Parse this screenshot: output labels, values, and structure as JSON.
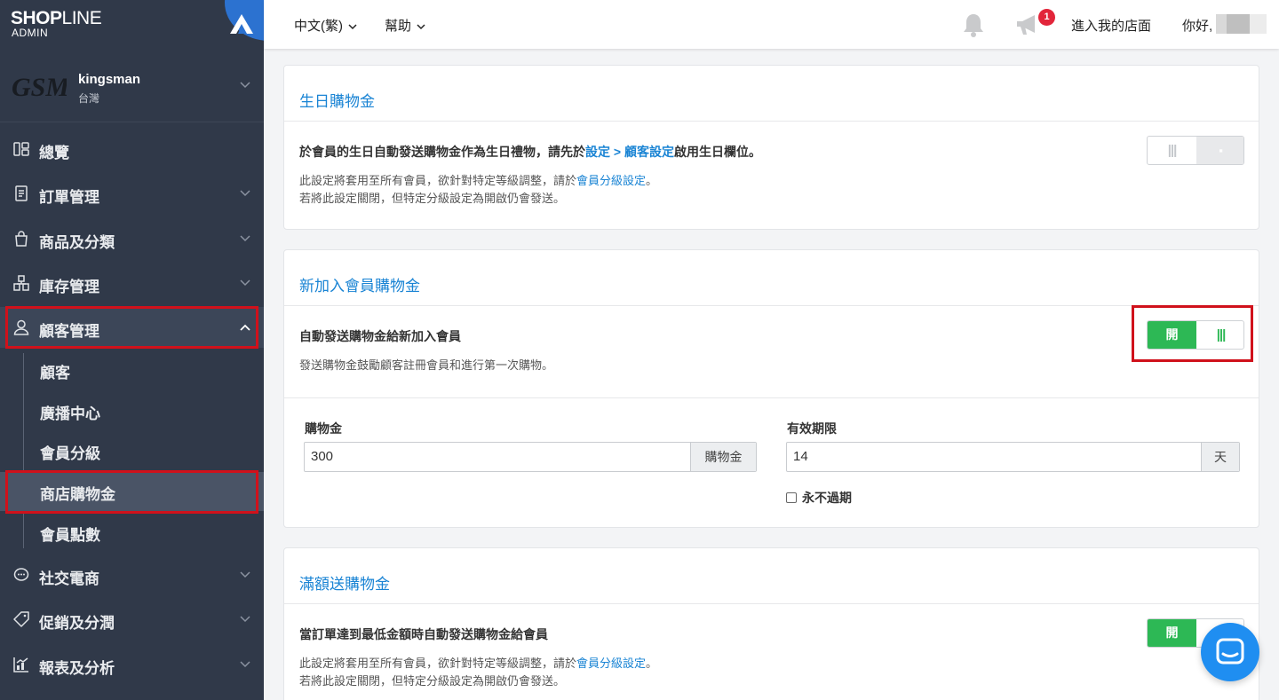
{
  "brand": {
    "name_bold": "SHOP",
    "name_light": "LINE",
    "sub": "ADMIN"
  },
  "store": {
    "logo_text": "GSM",
    "name": "kingsman",
    "region": "台灣"
  },
  "sidebar": {
    "items": [
      {
        "label": "總覽",
        "icon": "dashboard-icon"
      },
      {
        "label": "訂單管理",
        "icon": "order-icon"
      },
      {
        "label": "商品及分類",
        "icon": "bag-icon"
      },
      {
        "label": "庫存管理",
        "icon": "inventory-icon"
      },
      {
        "label": "顧客管理",
        "icon": "user-icon"
      },
      {
        "label": "社交電商",
        "icon": "chat-bubble-icon"
      },
      {
        "label": "促銷及分潤",
        "icon": "tag-icon"
      },
      {
        "label": "報表及分析",
        "icon": "chart-icon"
      }
    ],
    "sub_items": [
      {
        "label": "顧客"
      },
      {
        "label": "廣播中心"
      },
      {
        "label": "會員分級"
      },
      {
        "label": "商店購物金"
      },
      {
        "label": "會員點數"
      }
    ]
  },
  "header": {
    "language": "中文(繁)",
    "help": "幫助",
    "notification_badge": "1",
    "visit_store": "進入我的店面",
    "greeting": "你好,"
  },
  "birthday": {
    "title": "生日購物金",
    "desc_prefix": "於會員的生日自動發送購物金作為生日禮物，請先於",
    "desc_link": "設定 > 顧客設定",
    "desc_suffix": "啟用生日欄位。",
    "note1_prefix": "此設定將套用至所有會員，欲針對特定等級調整，請於",
    "note1_link": "會員分級設定",
    "note1_suffix": "。",
    "note2": "若將此設定關閉，但特定分級設定為開啟仍會發送。",
    "toggle_on": false
  },
  "newmember": {
    "title": "新加入會員購物金",
    "desc": "自動發送購物金給新加入會員",
    "note": "發送購物金鼓勵顧客註冊會員和進行第一次購物。",
    "toggle_label": "開",
    "toggle_on": true,
    "credit_label": "購物金",
    "credit_value": "300",
    "credit_addon": "購物金",
    "validity_label": "有效期限",
    "validity_value": "14",
    "validity_addon": "天",
    "never_expire": "永不過期",
    "never_expire_checked": false
  },
  "threshold": {
    "title": "滿額送購物金",
    "desc": "當訂單達到最低金額時自動發送購物金給會員",
    "note1_prefix": "此設定將套用至所有會員，欲針對特定等級調整，請於",
    "note1_link": "會員分級設定",
    "note1_suffix": "。",
    "note2": "若將此設定關閉，但特定分級設定為開啟仍會發送。",
    "toggle_label": "開",
    "toggle_on": true
  },
  "colors": {
    "accent": "#1a84d4",
    "toggle_on": "#2db855",
    "sidebar_bg": "#303949",
    "highlight": "#d0111b"
  }
}
